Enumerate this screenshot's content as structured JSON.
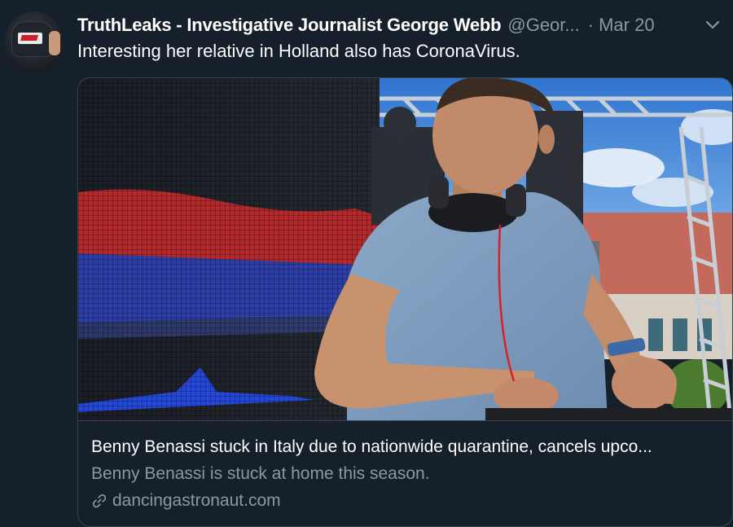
{
  "tweet": {
    "display_name": "TruthLeaks - Investigative Journalist George Webb",
    "handle": "@Geor...",
    "separator": "·",
    "date": "Mar 20",
    "text": "Interesting her relative in Holland also has CoronaVirus."
  },
  "card": {
    "title": "Benny Benassi stuck in Italy due to nationwide quarantine, cancels upco...",
    "description": "Benny Benassi is stuck at home this season.",
    "domain": "dancingastronaut.com",
    "icon": "link-icon"
  },
  "icons": {
    "menu": "chevron-down-icon",
    "avatar": "avatar-image"
  },
  "colors": {
    "background": "#15202b",
    "secondary_text": "#8899a6",
    "border": "#38444d"
  }
}
